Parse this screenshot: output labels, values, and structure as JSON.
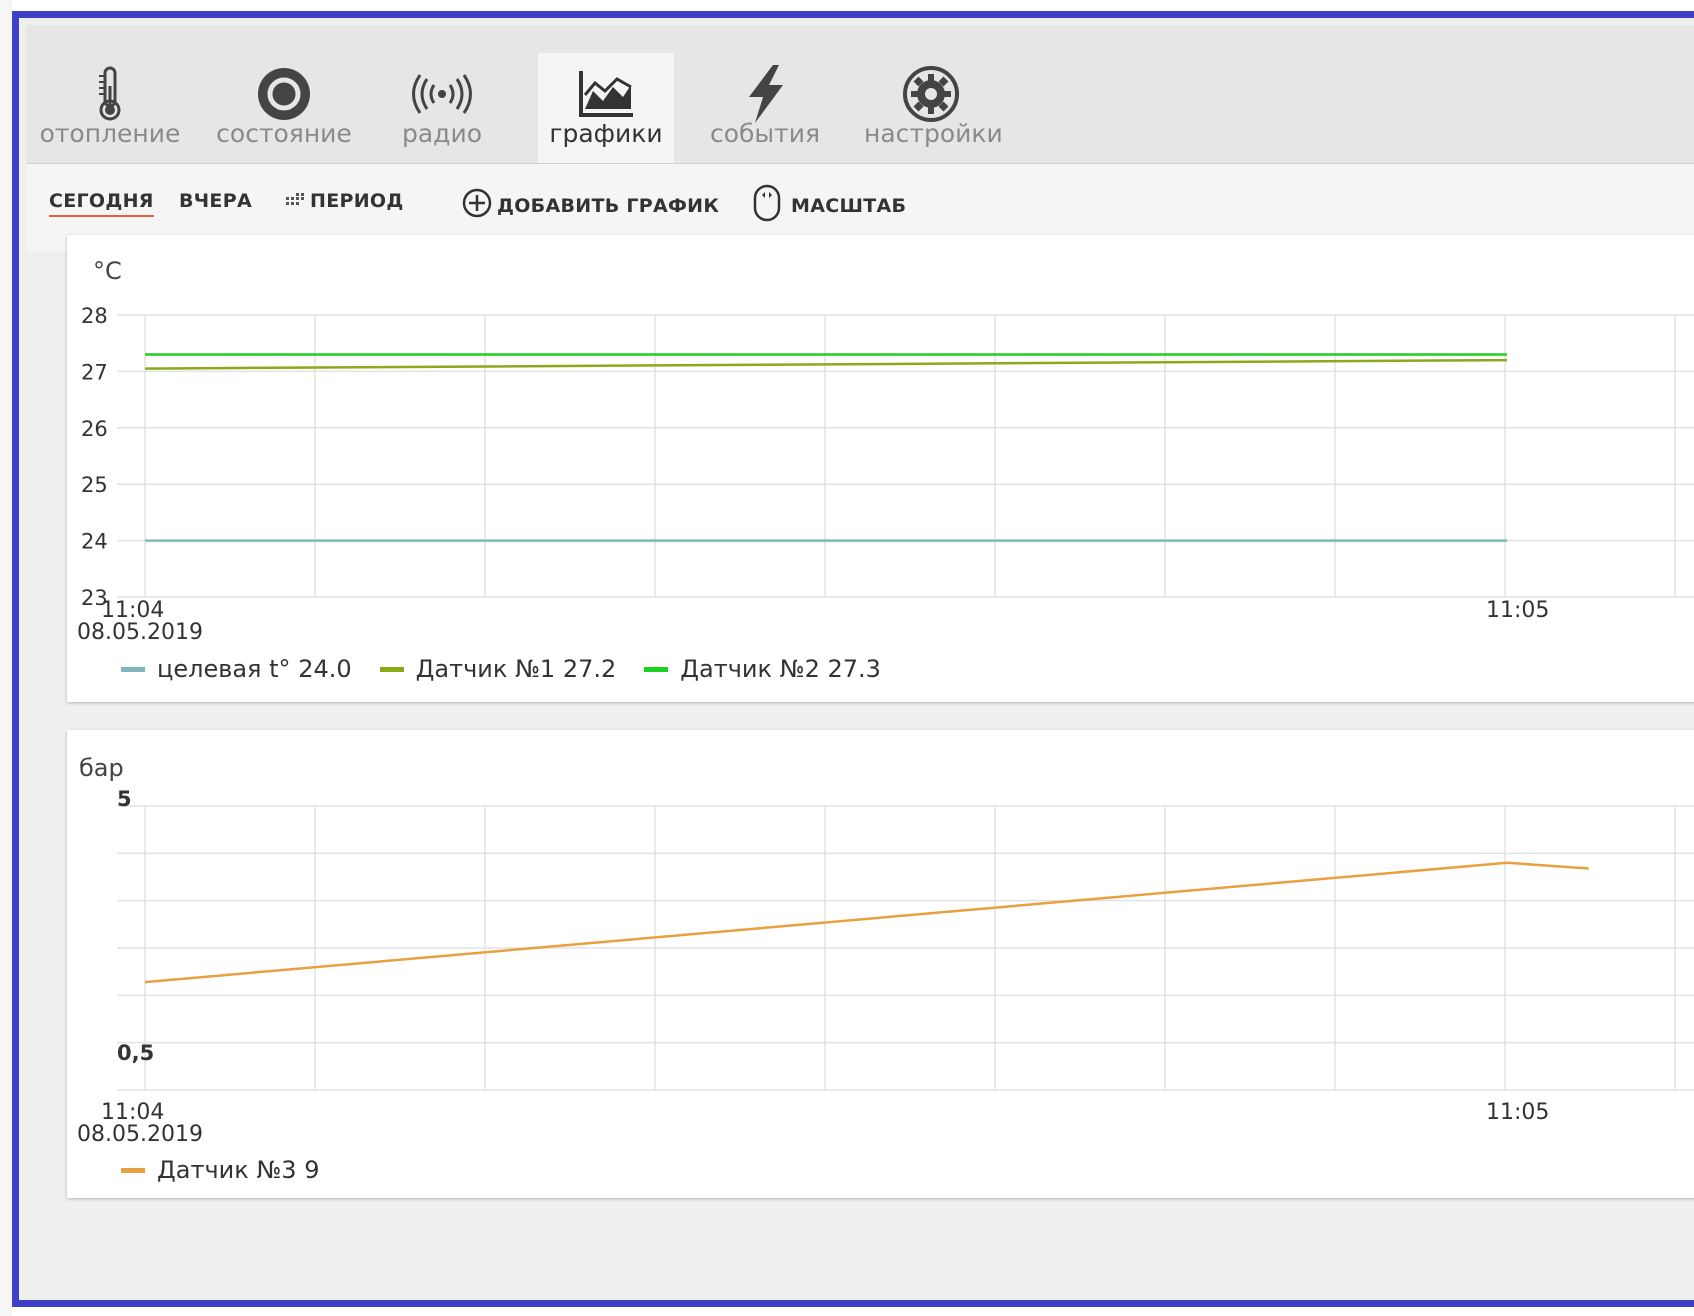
{
  "nav": {
    "tabs": [
      {
        "label": "отопление",
        "icon": "thermometer-icon"
      },
      {
        "label": "состояние",
        "icon": "status-ring-icon"
      },
      {
        "label": "радио",
        "icon": "radio-waves-icon"
      },
      {
        "label": "графики",
        "icon": "chart-icon",
        "active": true
      },
      {
        "label": "события",
        "icon": "lightning-icon"
      },
      {
        "label": "настройки",
        "icon": "gear-icon"
      }
    ]
  },
  "toolbar": {
    "today": "СЕГОДНЯ",
    "yesterday": "ВЧЕРА",
    "period": "ПЕРИОД",
    "add_chart": "ДОБАВИТЬ ГРАФИК",
    "scale": "МАСШТАБ"
  },
  "colors": {
    "accent": "#e2603d",
    "frame": "#3f3fc8",
    "target": "#7fb7bd",
    "sensor1": "#8aaa1a",
    "sensor2": "#1fcf1f",
    "sensor3": "#e8a040"
  },
  "chart_data": [
    {
      "type": "line",
      "unit": "°C",
      "y_ticks": [
        "28",
        "27",
        "26",
        "25",
        "24",
        "23"
      ],
      "ylim": [
        23,
        28
      ],
      "x_labels": [
        {
          "time": "11:04",
          "date": "08.05.2019"
        },
        {
          "time": "11:05",
          "date": ""
        }
      ],
      "grid": true,
      "series": [
        {
          "name": "целевая t°",
          "last_value": "24.0",
          "color": "#7fb7bd",
          "points": [
            [
              0,
              24.0
            ],
            [
              1,
              24.0
            ]
          ]
        },
        {
          "name": "Датчик №1",
          "last_value": "27.2",
          "color": "#8aaa1a",
          "points": [
            [
              0,
              27.05
            ],
            [
              1,
              27.2
            ]
          ]
        },
        {
          "name": "Датчик №2",
          "last_value": "27.3",
          "color": "#1fcf1f",
          "points": [
            [
              0,
              27.3
            ],
            [
              1,
              27.3
            ]
          ]
        }
      ]
    },
    {
      "type": "line",
      "unit": "бар",
      "y_ticks": [
        "5",
        "0,5"
      ],
      "ylim": [
        0,
        5
      ],
      "x_labels": [
        {
          "time": "11:04",
          "date": "08.05.2019"
        },
        {
          "time": "11:05",
          "date": ""
        }
      ],
      "grid": true,
      "series": [
        {
          "name": "Датчик №3",
          "last_value": "9",
          "color": "#e8a040",
          "points": [
            [
              0,
              1.9
            ],
            [
              1,
              4.0
            ],
            [
              1.06,
              3.9
            ]
          ]
        }
      ]
    }
  ]
}
